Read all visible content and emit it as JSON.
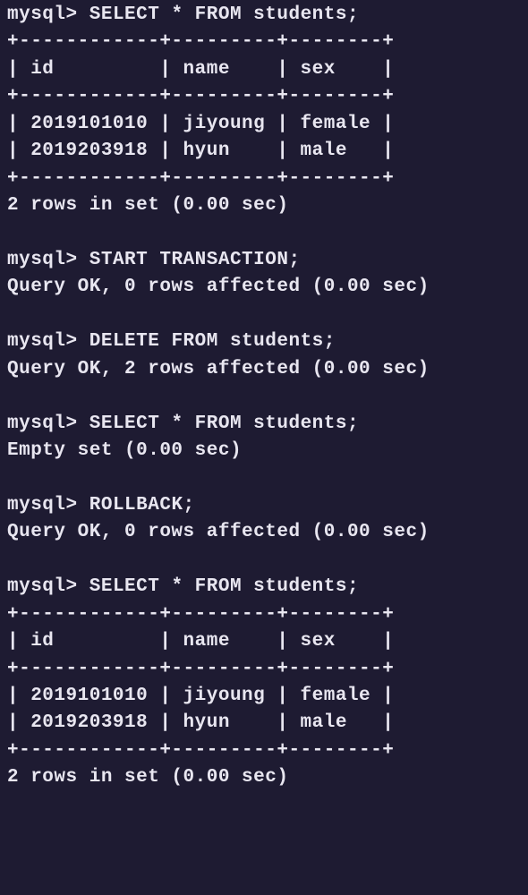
{
  "prompt": "mysql>",
  "queries": {
    "select": "SELECT * FROM students;",
    "start_transaction": "START TRANSACTION;",
    "delete": "DELETE FROM students;",
    "rollback": "ROLLBACK;"
  },
  "table1": {
    "border_top": "+------------+---------+--------+",
    "header": "| id         | name    | sex    |",
    "border_mid": "+------------+---------+--------+",
    "row1": "| 2019101010 | jiyoung | female |",
    "row2": "| 2019203918 | hyun    | male   |",
    "border_bot": "+------------+---------+--------+"
  },
  "results": {
    "rows_in_set": "2 rows in set (0.00 sec)",
    "query_ok_0": "Query OK, 0 rows affected (0.00 sec)",
    "query_ok_2": "Query OK, 2 rows affected (0.00 sec)",
    "empty_set": "Empty set (0.00 sec)"
  },
  "table2": {
    "border_top": "+------------+---------+--------+",
    "header": "| id         | name    | sex    |",
    "border_mid": "+------------+---------+--------+",
    "row1": "| 2019101010 | jiyoung | female |",
    "row2": "| 2019203918 | hyun    | male   |",
    "border_bot": "+------------+---------+--------+"
  }
}
